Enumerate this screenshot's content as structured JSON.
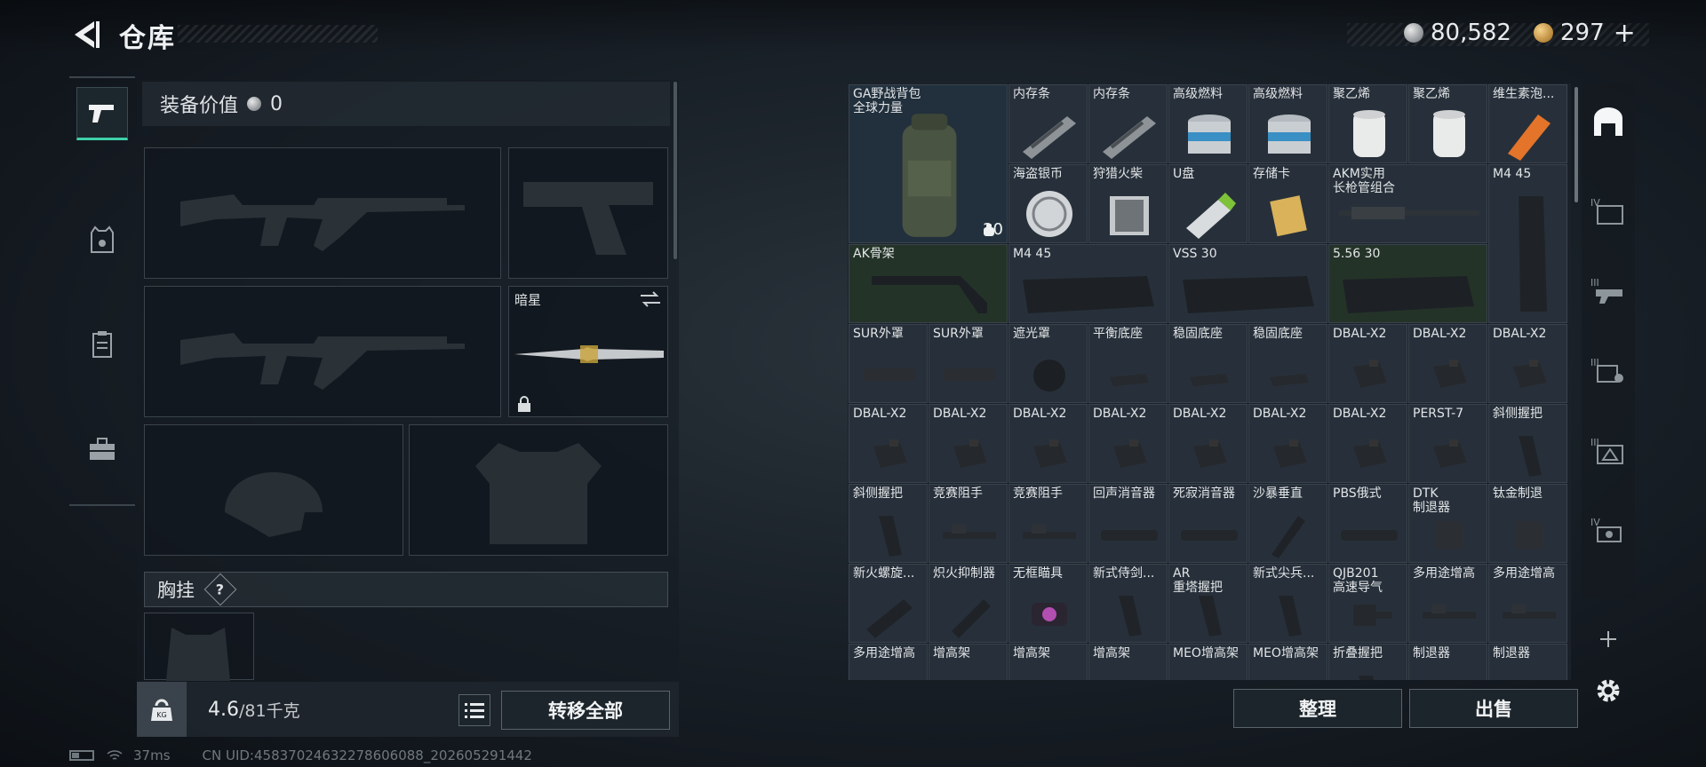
{
  "header": {
    "title": "仓库",
    "back_icon": "back-arrow-icon",
    "currency1": {
      "icon": "silver-coin-icon",
      "value": "80,582"
    },
    "currency2": {
      "icon": "gold-coin-icon",
      "value": "297"
    },
    "add_label": "+"
  },
  "loadout": {
    "value_label": "装备价值",
    "value": "0",
    "secondary_name": "暗星",
    "chest_label": "胸挂",
    "chest_help": "?",
    "weight_current": "4.6",
    "weight_max": "/81千克",
    "transfer_all": "转移全部"
  },
  "grid_actions": {
    "sort": "整理",
    "sell": "出售"
  },
  "items": [
    {
      "name": "GA野战背包\n全球力量",
      "badge": "20"
    },
    {
      "name": "内存条"
    },
    {
      "name": "内存条"
    },
    {
      "name": "高级燃料"
    },
    {
      "name": "高级燃料"
    },
    {
      "name": "聚乙烯"
    },
    {
      "name": "聚乙烯"
    },
    {
      "name": "维生素泡..."
    },
    {
      "name": "海盗银币"
    },
    {
      "name": "狩猎火柴"
    },
    {
      "name": "U盘"
    },
    {
      "name": "存储卡"
    },
    {
      "name": "AKM实用\n长枪管组合"
    },
    {
      "name": "M4 45"
    },
    {
      "name": "AK骨架"
    },
    {
      "name": "M4 45"
    },
    {
      "name": "VSS 30"
    },
    {
      "name": "5.56 30"
    },
    {
      "name": "SUR外罩"
    },
    {
      "name": "SUR外罩"
    },
    {
      "name": "遮光罩"
    },
    {
      "name": "平衡底座"
    },
    {
      "name": "稳固底座"
    },
    {
      "name": "稳固底座"
    },
    {
      "name": "DBAL-X2"
    },
    {
      "name": "DBAL-X2"
    },
    {
      "name": "DBAL-X2"
    },
    {
      "name": "DBAL-X2"
    },
    {
      "name": "DBAL-X2"
    },
    {
      "name": "DBAL-X2"
    },
    {
      "name": "DBAL-X2"
    },
    {
      "name": "DBAL-X2"
    },
    {
      "name": "DBAL-X2"
    },
    {
      "name": "DBAL-X2"
    },
    {
      "name": "PERST-7"
    },
    {
      "name": "斜侧握把"
    },
    {
      "name": "斜侧握把"
    },
    {
      "name": "竞赛阻手"
    },
    {
      "name": "竞赛阻手"
    },
    {
      "name": "回声消音器"
    },
    {
      "name": "死寂消音器"
    },
    {
      "name": "沙暴垂直"
    },
    {
      "name": "PBS俄式"
    },
    {
      "name": "DTK\n制退器"
    },
    {
      "name": "钛金制退"
    },
    {
      "name": "新火螺旋..."
    },
    {
      "name": "炽火抑制器"
    },
    {
      "name": "无框瞄具"
    },
    {
      "name": "新式侍剑..."
    },
    {
      "name": "AR\n重塔握把"
    },
    {
      "name": "新式尖兵..."
    },
    {
      "name": "QJB201\n高速导气"
    },
    {
      "name": "多用途增高"
    },
    {
      "name": "多用途增高"
    },
    {
      "name": "多用途增高"
    },
    {
      "name": "增高架"
    },
    {
      "name": "增高架"
    },
    {
      "name": "增高架"
    },
    {
      "name": "MEO增高架"
    },
    {
      "name": "MEO增高架"
    },
    {
      "name": "折叠握把"
    },
    {
      "name": "制退器"
    },
    {
      "name": "制退器"
    }
  ],
  "status": {
    "ping": "37ms",
    "uid": "CN UID:45837024632278606088_202605291442"
  }
}
